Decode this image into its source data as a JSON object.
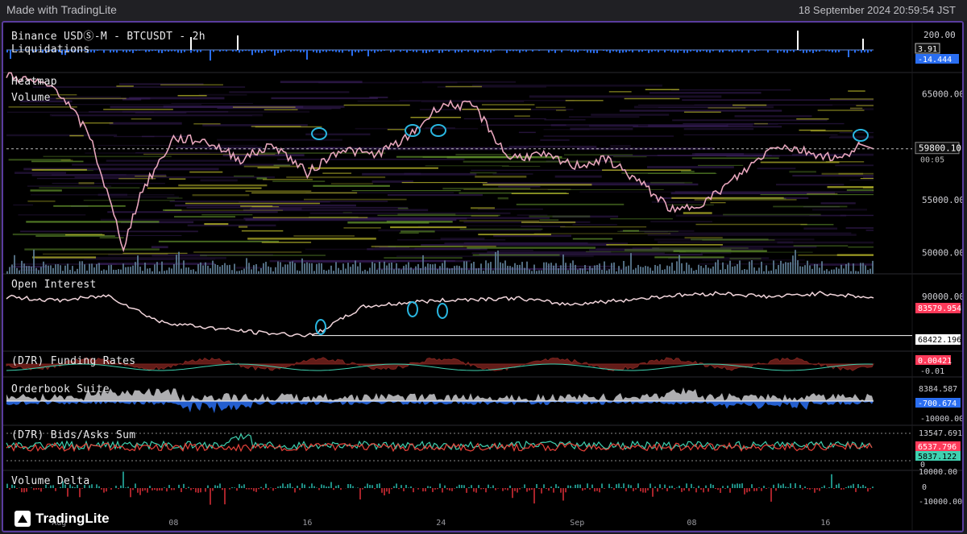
{
  "header": {
    "made_with": "Made with TradingLite",
    "timestamp": "18 September 2024 20:59:54 JST"
  },
  "brand": {
    "logo_text": "TradingLite"
  },
  "colors": {
    "accent_purple": "#5a3c9e",
    "price_up": "#e05080",
    "red": "#e8423a",
    "blue": "#2a6ef2",
    "teal": "#3fd1b0",
    "pink_tag": "#ff3a5a"
  },
  "chart_data": [
    {
      "title": "Binance USDⓈ-M - BTCUSDT - 2h",
      "type": "bar",
      "pane": "Liquidations",
      "axis_ticks": [
        "200.00"
      ],
      "last_values": [
        "3.91",
        "-14.444"
      ]
    },
    {
      "type": "heatmap",
      "pane_labels": [
        "Heatmap",
        "Volume"
      ],
      "axis_ticks": [
        "65000.00",
        "55000.00",
        "50000.00"
      ],
      "ylim": [
        48000,
        67000
      ],
      "current_price": "59800.10",
      "countdown": "00:05",
      "x_ticks": [
        "Aug",
        "08",
        "16",
        "24",
        "Sep",
        "08",
        "16"
      ],
      "price_series": [
        {
          "date": "2024-07-29",
          "close": 66800
        },
        {
          "date": "2024-08-01",
          "close": 65500
        },
        {
          "date": "2024-08-03",
          "close": 61000
        },
        {
          "date": "2024-08-05",
          "close": 50500
        },
        {
          "date": "2024-08-06",
          "close": 55500
        },
        {
          "date": "2024-08-08",
          "close": 60800
        },
        {
          "date": "2024-08-10",
          "close": 60500
        },
        {
          "date": "2024-08-12",
          "close": 58800
        },
        {
          "date": "2024-08-14",
          "close": 60200
        },
        {
          "date": "2024-08-16",
          "close": 57500
        },
        {
          "date": "2024-08-18",
          "close": 59800
        },
        {
          "date": "2024-08-20",
          "close": 59200
        },
        {
          "date": "2024-08-22",
          "close": 60800
        },
        {
          "date": "2024-08-24",
          "close": 64000
        },
        {
          "date": "2024-08-26",
          "close": 63800
        },
        {
          "date": "2024-08-28",
          "close": 59000
        },
        {
          "date": "2024-08-30",
          "close": 59200
        },
        {
          "date": "2024-09-01",
          "close": 58200
        },
        {
          "date": "2024-09-03",
          "close": 58800
        },
        {
          "date": "2024-09-05",
          "close": 56500
        },
        {
          "date": "2024-09-07",
          "close": 53800
        },
        {
          "date": "2024-09-09",
          "close": 55000
        },
        {
          "date": "2024-09-11",
          "close": 57500
        },
        {
          "date": "2024-09-13",
          "close": 60200
        },
        {
          "date": "2024-09-15",
          "close": 59500
        },
        {
          "date": "2024-09-17",
          "close": 58800
        },
        {
          "date": "2024-09-18",
          "close": 60400
        },
        {
          "date": "2024-09-18",
          "close": 59800
        }
      ]
    },
    {
      "type": "line",
      "pane": "Open Interest",
      "axis_ticks": [
        "90000.00"
      ],
      "last_values": [
        "83579.954",
        "68422.196"
      ],
      "values_approx": [
        84000,
        82500,
        84500,
        74000,
        71500,
        69500,
        68422,
        80000,
        82000,
        83000,
        83500,
        81000,
        82500,
        84500,
        85500,
        84000,
        85500,
        83579
      ]
    },
    {
      "type": "area",
      "pane": "(D7R) Funding Rates",
      "last_values": [
        "0.00421",
        "-0.01"
      ]
    },
    {
      "type": "area",
      "pane": "Orderbook Suite",
      "last_values": [
        "8384.587",
        "-700.674",
        "-10000.00"
      ]
    },
    {
      "type": "line",
      "pane": "(D7R) Bids/Asks Sum",
      "last_values": [
        "13547.691",
        "6537.796",
        "5837.122",
        "0"
      ]
    },
    {
      "type": "bar",
      "pane": "Volume Delta",
      "axis_ticks": [
        "10000.00",
        "0",
        "-10000.00"
      ]
    }
  ]
}
